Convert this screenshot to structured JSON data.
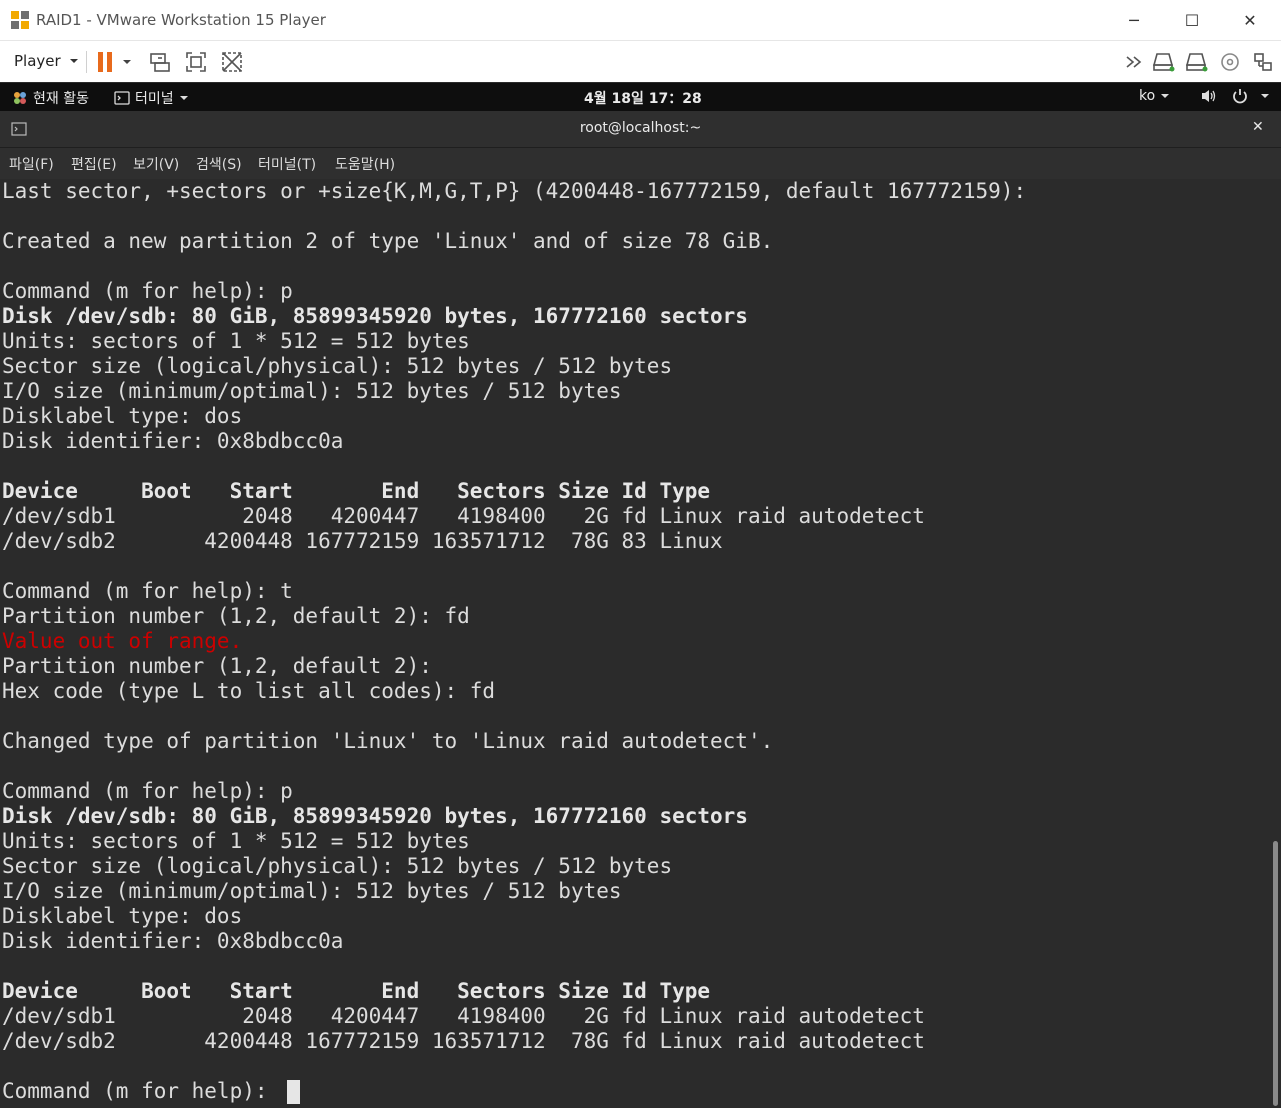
{
  "window": {
    "title": "RAID1 - VMware Workstation 15 Player",
    "minimize_glyph": "─",
    "maximize_glyph": "☐",
    "close_glyph": "✕"
  },
  "toolbar": {
    "player_label": "Player",
    "accent": "#e86a1c"
  },
  "gnome_bar": {
    "activities": "현재 활동",
    "terminal_app": "터미널",
    "clock": "4월 18일  17：28",
    "input_method": "ko"
  },
  "terminal": {
    "title": "root@localhost:~",
    "close_glyph": "✕",
    "menu": [
      "파일(F)",
      "편집(E)",
      "보기(V)",
      "검색(S)",
      "터미널(T)",
      "도움말(H)"
    ],
    "lines": [
      "Last sector, +sectors or +size{K,M,G,T,P} (4200448-167772159, default 167772159):",
      "",
      "Created a new partition 2 of type 'Linux' and of size 78 GiB.",
      "",
      "Command (m for help): p",
      "Disk /dev/sdb: 80 GiB, 85899345920 bytes, 167772160 sectors",
      "Units: sectors of 1 * 512 = 512 bytes",
      "Sector size (logical/physical): 512 bytes / 512 bytes",
      "I/O size (minimum/optimal): 512 bytes / 512 bytes",
      "Disklabel type: dos",
      "Disk identifier: 0x8bdbcc0a",
      "",
      "Device     Boot   Start       End   Sectors Size Id Type",
      "/dev/sdb1          2048   4200447   4198400   2G fd Linux raid autodetect",
      "/dev/sdb2       4200448 167772159 163571712  78G 83 Linux",
      "",
      "Command (m for help): t",
      "Partition number (1,2, default 2): fd",
      "Value out of range.",
      "Partition number (1,2, default 2):",
      "Hex code (type L to list all codes): fd",
      "",
      "Changed type of partition 'Linux' to 'Linux raid autodetect'.",
      "",
      "Command (m for help): p",
      "Disk /dev/sdb: 80 GiB, 85899345920 bytes, 167772160 sectors",
      "Units: sectors of 1 * 512 = 512 bytes",
      "Sector size (logical/physical): 512 bytes / 512 bytes",
      "I/O size (minimum/optimal): 512 bytes / 512 bytes",
      "Disklabel type: dos",
      "Disk identifier: 0x8bdbcc0a",
      "",
      "Device     Boot   Start       End   Sectors Size Id Type",
      "/dev/sdb1          2048   4200447   4198400   2G fd Linux raid autodetect",
      "/dev/sdb2       4200448 167772159 163571712  78G fd Linux raid autodetect",
      "",
      "Command (m for help): "
    ],
    "bold_lines": [
      5,
      12,
      25,
      32
    ],
    "error_lines": [
      18
    ],
    "error_color": "#cc0000"
  }
}
